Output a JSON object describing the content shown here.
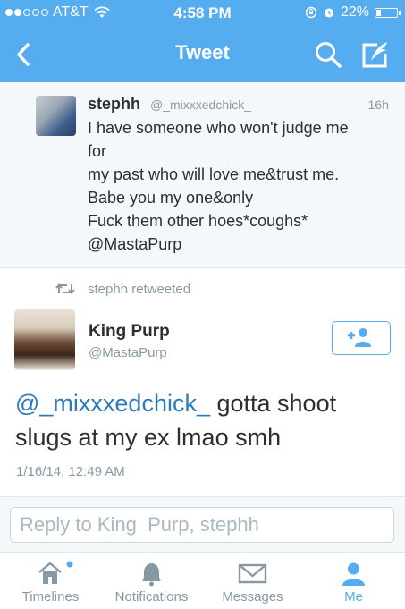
{
  "status": {
    "carrier": "AT&T",
    "time": "4:58 PM",
    "battery": "22%",
    "battery_level": 0.22,
    "signal_bars_filled": 2
  },
  "nav": {
    "title": "Tweet",
    "back_icon": "chevron-left-icon",
    "search_icon": "search-icon",
    "compose_icon": "compose-icon"
  },
  "parent_tweet": {
    "name": "stephh",
    "handle": "@_mixxxedchick_",
    "time": "16h",
    "lines": [
      "I have someone who won't judge me",
      "for",
      "my past who will love me&trust me.",
      "Babe you my one&only",
      "Fuck them other hoes*coughs*",
      "@MastaPurp"
    ]
  },
  "retweet": {
    "label": "stephh retweeted"
  },
  "main_tweet": {
    "name": "King  Purp",
    "handle": "@MastaPurp",
    "mention": "@_mixxxedchick_",
    "text": " gotta shoot slugs at my ex lmao smh",
    "timestamp": "1/16/14, 12:49 AM"
  },
  "reply": {
    "placeholder": "Reply to King  Purp, stephh"
  },
  "tabs": [
    {
      "label": "Timelines",
      "icon": "home-icon"
    },
    {
      "label": "Notifications",
      "icon": "bell-icon"
    },
    {
      "label": "Messages",
      "icon": "envelope-icon"
    },
    {
      "label": "Me",
      "icon": "person-icon"
    }
  ],
  "colors": {
    "brand": "#55acee",
    "link": "#2b7bb9",
    "secondary_text": "#8899a6",
    "text": "#292f33"
  }
}
